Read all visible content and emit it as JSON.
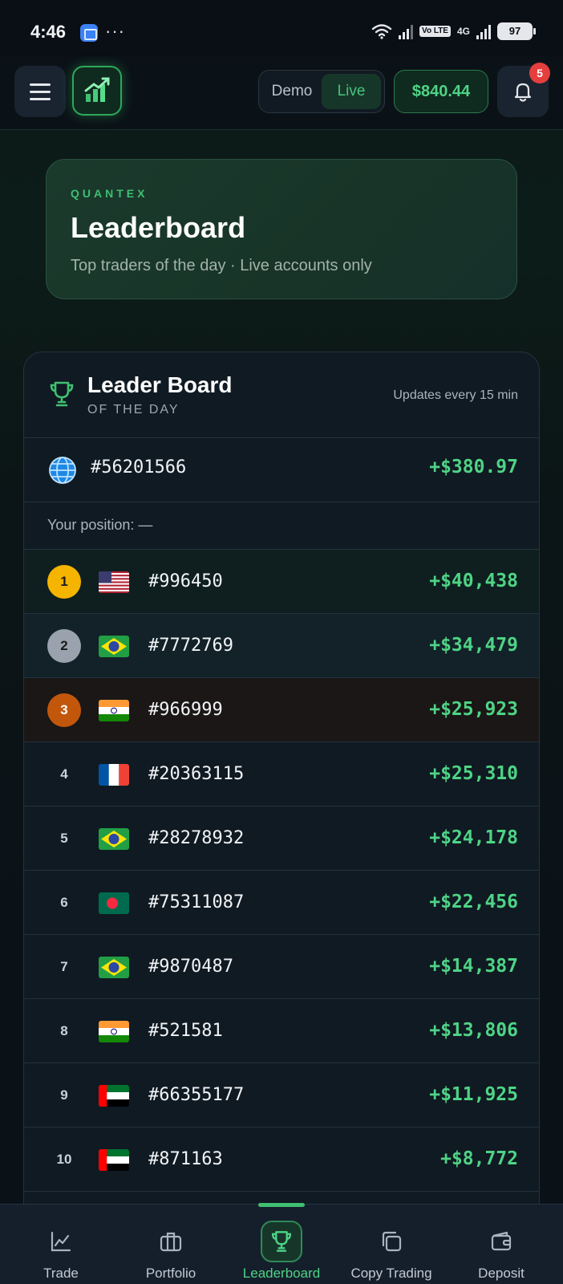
{
  "status_bar": {
    "time": "4:46",
    "dots": "···",
    "volte_tag": "Vo LTE",
    "network": "4G",
    "battery": "97"
  },
  "header": {
    "mode_demo": "Demo",
    "mode_live": "Live",
    "active_mode": "Live",
    "balance": "$840.44",
    "notification_count": "5",
    "accent_color": "#3fbf72"
  },
  "hero": {
    "kicker": "QUANTEX",
    "title": "Leaderboard",
    "subtitle": "Top traders of the day · Live accounts only"
  },
  "leaderboard": {
    "title": "Leader Board",
    "subtitle": "OF THE DAY",
    "update_note": "Updates every 15 min",
    "my_entry": {
      "icon": "globe-icon",
      "trader_id": "#56201566",
      "profit": "+$380.97"
    },
    "position_label": "Your position: —",
    "rows": [
      {
        "rank": "1",
        "flag": "us",
        "trader_id": "#996450",
        "profit": "+$40,438"
      },
      {
        "rank": "2",
        "flag": "br",
        "trader_id": "#7772769",
        "profit": "+$34,479"
      },
      {
        "rank": "3",
        "flag": "in",
        "trader_id": "#966999",
        "profit": "+$25,923"
      },
      {
        "rank": "4",
        "flag": "fr",
        "trader_id": "#20363115",
        "profit": "+$25,310"
      },
      {
        "rank": "5",
        "flag": "br",
        "trader_id": "#28278932",
        "profit": "+$24,178"
      },
      {
        "rank": "6",
        "flag": "bd",
        "trader_id": "#75311087",
        "profit": "+$22,456"
      },
      {
        "rank": "7",
        "flag": "br",
        "trader_id": "#9870487",
        "profit": "+$14,387"
      },
      {
        "rank": "8",
        "flag": "in",
        "trader_id": "#521581",
        "profit": "+$13,806"
      },
      {
        "rank": "9",
        "flag": "ae",
        "trader_id": "#66355177",
        "profit": "+$11,925"
      },
      {
        "rank": "10",
        "flag": "ae",
        "trader_id": "#871163",
        "profit": "+$8,772"
      }
    ]
  },
  "nav": {
    "items": [
      {
        "label": "Trade",
        "icon": "chart-line-icon"
      },
      {
        "label": "Portfolio",
        "icon": "briefcase-icon"
      },
      {
        "label": "Leaderboard",
        "icon": "trophy-icon"
      },
      {
        "label": "Copy Trading",
        "icon": "copy-icon"
      },
      {
        "label": "Deposit",
        "icon": "wallet-icon"
      }
    ],
    "active": "Leaderboard"
  }
}
